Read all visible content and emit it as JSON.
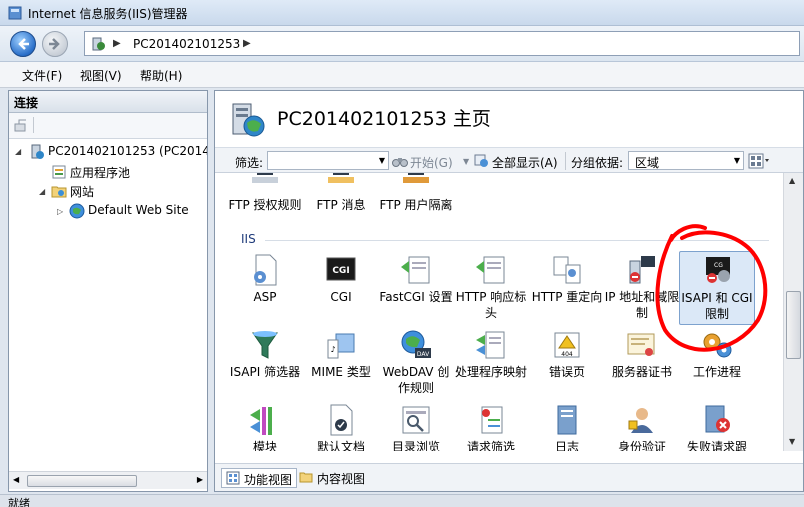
{
  "window": {
    "title": "Internet 信息服务(IIS)管理器"
  },
  "address": {
    "crumb": "PC201402101253"
  },
  "menu": {
    "file": "文件(F)",
    "view": "视图(V)",
    "help": "帮助(H)"
  },
  "left_pane": {
    "header": "连接",
    "tree": {
      "server": "PC201402101253 (PC20140",
      "app_pools": "应用程序池",
      "sites": "网站",
      "default_site": "Default Web Site"
    }
  },
  "main": {
    "title": "PC201402101253 主页",
    "filter": {
      "label": "筛选:",
      "start": "开始(G)",
      "show_all": "全部显示(A)",
      "group_label": "分组依据:",
      "group_value": "区域"
    },
    "ftp_items": [
      "FTP 授权规则",
      "FTP 消息",
      "FTP 用户隔离"
    ],
    "group_iis": "IIS",
    "row1": [
      "ASP",
      "CGI",
      "FastCGI 设置",
      "HTTP 响应标头",
      "HTTP 重定向",
      "IP 地址和域限制",
      "ISAPI 和 CGI 限制"
    ],
    "row2": [
      "ISAPI 筛选器",
      "MIME 类型",
      "WebDAV 创作规则",
      "处理程序映射",
      "错误页",
      "服务器证书",
      "工作进程"
    ],
    "row3": [
      "模块",
      "默认文档",
      "目录浏览",
      "请求筛选",
      "日志",
      "身份验证",
      "失败请求跟"
    ]
  },
  "tabs": {
    "features": "功能视图",
    "content": "内容视图"
  },
  "status": {
    "text": "就绪"
  },
  "colors": {
    "selection": "#dbe8f7",
    "annotation_red": "#ff0000",
    "link_blue": "#1e3a7a"
  }
}
